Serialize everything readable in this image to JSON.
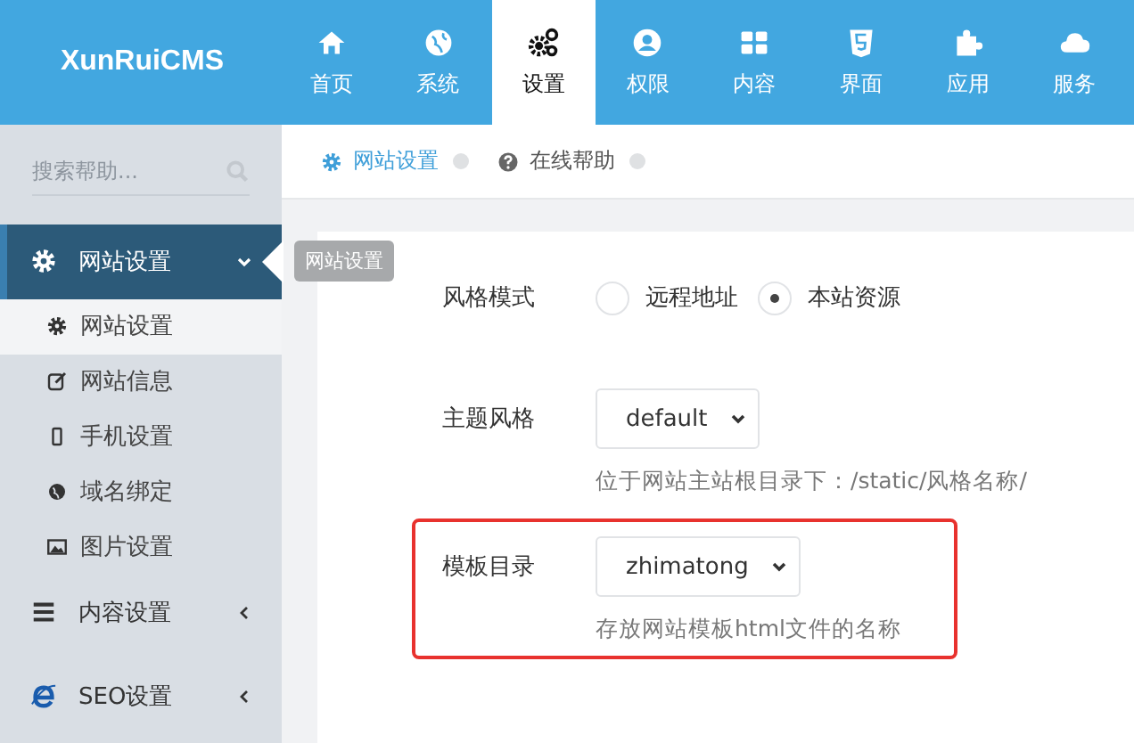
{
  "logo": {
    "text": "XunRuiCMS"
  },
  "nav": [
    {
      "label": "首页",
      "kind": "home",
      "selected": false
    },
    {
      "label": "系统",
      "kind": "globe",
      "selected": false
    },
    {
      "label": "设置",
      "kind": "gears",
      "selected": true
    },
    {
      "label": "权限",
      "kind": "user",
      "selected": false
    },
    {
      "label": "内容",
      "kind": "grid",
      "selected": false
    },
    {
      "label": "界面",
      "kind": "html5",
      "selected": false
    },
    {
      "label": "应用",
      "kind": "puzzle",
      "selected": false
    },
    {
      "label": "服务",
      "kind": "cloud",
      "selected": false
    }
  ],
  "sidebar": {
    "search": {
      "placeholder": "搜索帮助..."
    },
    "groups": [
      {
        "label": "网站设置",
        "kind": "gear",
        "expanded": true,
        "tooltip": "网站设置",
        "children": [
          {
            "label": "网站设置",
            "kind": "gear",
            "selected": true
          },
          {
            "label": "网站信息",
            "kind": "edit",
            "selected": false
          },
          {
            "label": "手机设置",
            "kind": "phone",
            "selected": false
          },
          {
            "label": "域名绑定",
            "kind": "globe",
            "selected": false
          },
          {
            "label": "图片设置",
            "kind": "image",
            "selected": false
          }
        ]
      },
      {
        "label": "内容设置",
        "kind": "bars",
        "expanded": false
      },
      {
        "label": "SEO设置",
        "kind": "ie",
        "expanded": false
      }
    ]
  },
  "breadcrumb": [
    {
      "label": "网站设置",
      "kind": "gear",
      "selected": true
    },
    {
      "label": "在线帮助",
      "kind": "help",
      "selected": false
    }
  ],
  "form": [
    {
      "kind": "radio",
      "label": "风格模式",
      "options": [
        {
          "label": "远程地址",
          "selected": false
        },
        {
          "label": "本站资源",
          "selected": true
        }
      ]
    },
    {
      "kind": "select",
      "label": "主题风格",
      "value": "default",
      "hint": "位于网站主站根目录下：/static/风格名称/",
      "highlighted": false
    },
    {
      "kind": "select",
      "label": "模板目录",
      "value": "zhimatong",
      "hint": "存放网站模板html文件的名称",
      "highlighted": true
    }
  ]
}
